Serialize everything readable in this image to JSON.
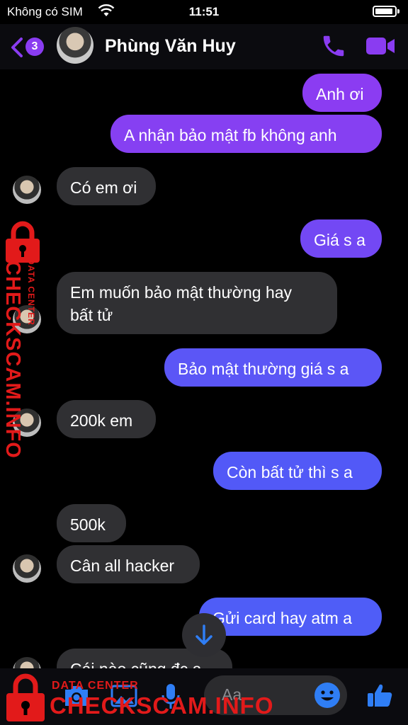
{
  "status": {
    "carrier": "Không có SIM",
    "time": "11:51"
  },
  "header": {
    "unread_count": "3",
    "contact_name": "Phùng Văn Huy"
  },
  "messages": [
    {
      "from": "me",
      "text": "Anh ơi"
    },
    {
      "from": "me",
      "text": "A nhận bảo mật fb không anh"
    },
    {
      "from": "them",
      "text": "Có em ơi"
    },
    {
      "from": "me",
      "text": "Giá s a"
    },
    {
      "from": "them",
      "text": "Em muốn bảo mật thường hay",
      "text2": "bất tử"
    },
    {
      "from": "me",
      "text": "Bảo mật thường giá s a"
    },
    {
      "from": "them",
      "text": "200k em"
    },
    {
      "from": "me",
      "text": "Còn bất tử thì s a"
    },
    {
      "from": "them",
      "text": "500k"
    },
    {
      "from": "them",
      "text": "Cân all hacker"
    },
    {
      "from": "me",
      "text": "Gửi card hay atm a"
    },
    {
      "from": "them",
      "text": "Cái nào cũng đc a"
    }
  ],
  "composer": {
    "placeholder": "Aa"
  },
  "watermark": {
    "brand": "CHECKSCAM.INFO",
    "tagline": "DATA CENTER"
  },
  "colors": {
    "accent": "#8a3cf1",
    "out_top": "#8b3cf2",
    "out_bottom": "#4f5df7",
    "in": "#303033",
    "watermark": "#e21a1a"
  }
}
